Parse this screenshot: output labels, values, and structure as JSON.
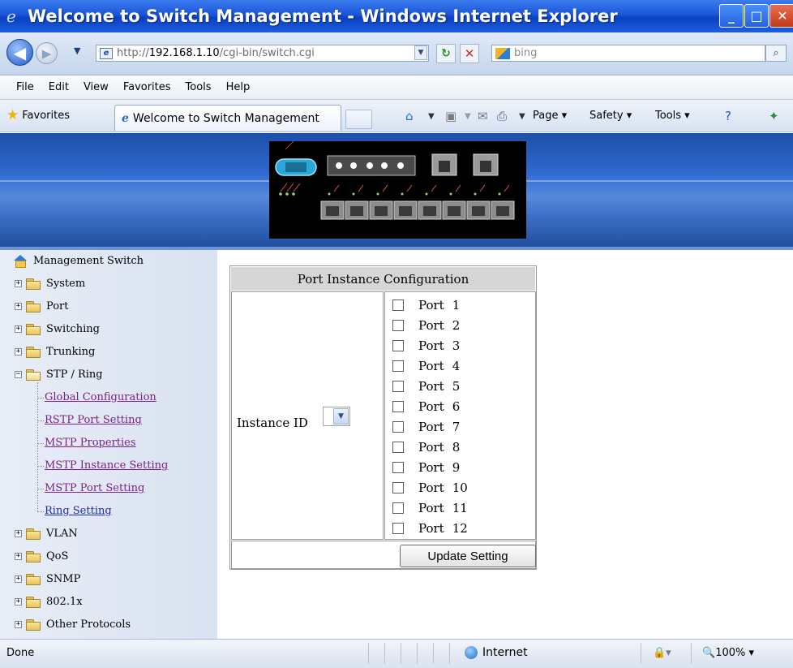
{
  "window": {
    "title": "Welcome to Switch Management - Windows Internet Explorer",
    "title_icon": "ie-logo-icon"
  },
  "address_bar": {
    "url_scheme": "http://",
    "url_host": "192.168.1.10",
    "url_path": "/cgi-bin/switch.cgi",
    "search_placeholder": "bing"
  },
  "menu": [
    "File",
    "Edit",
    "View",
    "Favorites",
    "Tools",
    "Help"
  ],
  "favorites_bar": {
    "favorites_label": "Favorites",
    "active_tab_title": "Welcome to Switch Management",
    "commands": {
      "page": "Page ▾",
      "safety": "Safety ▾",
      "tools": "Tools ▾"
    }
  },
  "sidebar": {
    "root": "Management Switch",
    "items": [
      {
        "label": "System",
        "expanded": false
      },
      {
        "label": "Port",
        "expanded": false
      },
      {
        "label": "Switching",
        "expanded": false
      },
      {
        "label": "Trunking",
        "expanded": false
      },
      {
        "label": "STP / Ring",
        "expanded": true
      },
      {
        "label": "VLAN",
        "expanded": false
      },
      {
        "label": "QoS",
        "expanded": false
      },
      {
        "label": "SNMP",
        "expanded": false
      },
      {
        "label": "802.1x",
        "expanded": false
      },
      {
        "label": "Other Protocols",
        "expanded": false
      }
    ],
    "stp_children": [
      "Global Configuration",
      "RSTP Port Setting",
      "MSTP Properties",
      "MSTP Instance Setting",
      "MSTP Port Setting",
      "Ring Setting"
    ],
    "active_child": "Ring Setting"
  },
  "config": {
    "title": "Port Instance Configuration",
    "instance_label": "Instance ID",
    "instance_value": "",
    "port_word": "Port",
    "ports": [
      "1",
      "2",
      "3",
      "4",
      "5",
      "6",
      "7",
      "8",
      "9",
      "10",
      "11",
      "12"
    ],
    "update_button": "Update Setting"
  },
  "status_bar": {
    "status": "Done",
    "zone": "Internet",
    "zoom": "100%"
  },
  "colors": {
    "title_bar": "#1a55d6",
    "banner": "#2f6ad0",
    "visited_link": "#7b2085",
    "link": "#1b2ea8",
    "table_header": "#d6d6d6"
  }
}
